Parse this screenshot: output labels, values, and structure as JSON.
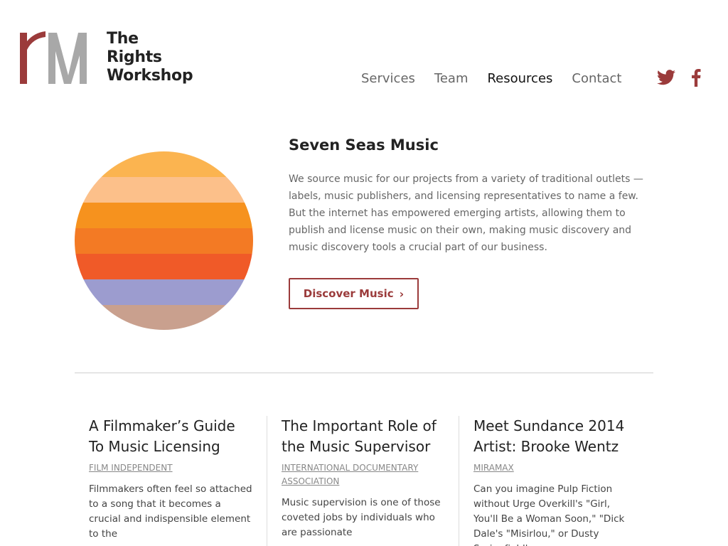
{
  "brand": {
    "name_lines": [
      "The",
      "Rights",
      "Workshop"
    ],
    "logo_icon": "rw-monogram"
  },
  "nav": {
    "items": [
      {
        "label": "Services",
        "active": false
      },
      {
        "label": "Team",
        "active": false
      },
      {
        "label": "Resources",
        "active": true
      },
      {
        "label": "Contact",
        "active": false
      }
    ]
  },
  "social": {
    "icons": [
      "twitter-icon",
      "facebook-icon"
    ],
    "color": "#9b3b3b"
  },
  "feature": {
    "title": "Seven Seas Music",
    "description": "We source music for our projects from a variety of traditional outlets — labels, music publishers, and licensing representatives to name a few. But the internet has empowered emerging artists, allowing them to publish and license music on their own, making music discovery and music discovery tools a crucial part of our business.",
    "button_label": "Discover Music",
    "button_icon": "chevron-right-icon",
    "circle_stripes": [
      "#fbb450",
      "#fcc08a",
      "#f6921e",
      "#f37a24",
      "#f05a28",
      "#9c9ccf",
      "#c9a08e"
    ]
  },
  "articles": [
    {
      "title": "A Filmmaker’s Guide To Music Licensing",
      "source": "FILM INDEPENDENT",
      "excerpt": "Filmmakers often feel so attached to a song that it becomes a crucial and indispensible element to the"
    },
    {
      "title": "The Important Role of the Music Supervisor",
      "source": "INTERNATIONAL DOCUMENTARY ASSOCIATION",
      "excerpt": "Music supervision is one of those coveted jobs by individuals who are passionate"
    },
    {
      "title": "Meet Sundance 2014 Artist: Brooke Wentz",
      "source": "MIRAMAX",
      "excerpt": "Can you imagine Pulp Fiction without Urge Overkill's \"Girl, You'll Be a Woman Soon,\" \"Dick Dale's \"Misirlou,\" or Dusty Springfield's"
    }
  ]
}
